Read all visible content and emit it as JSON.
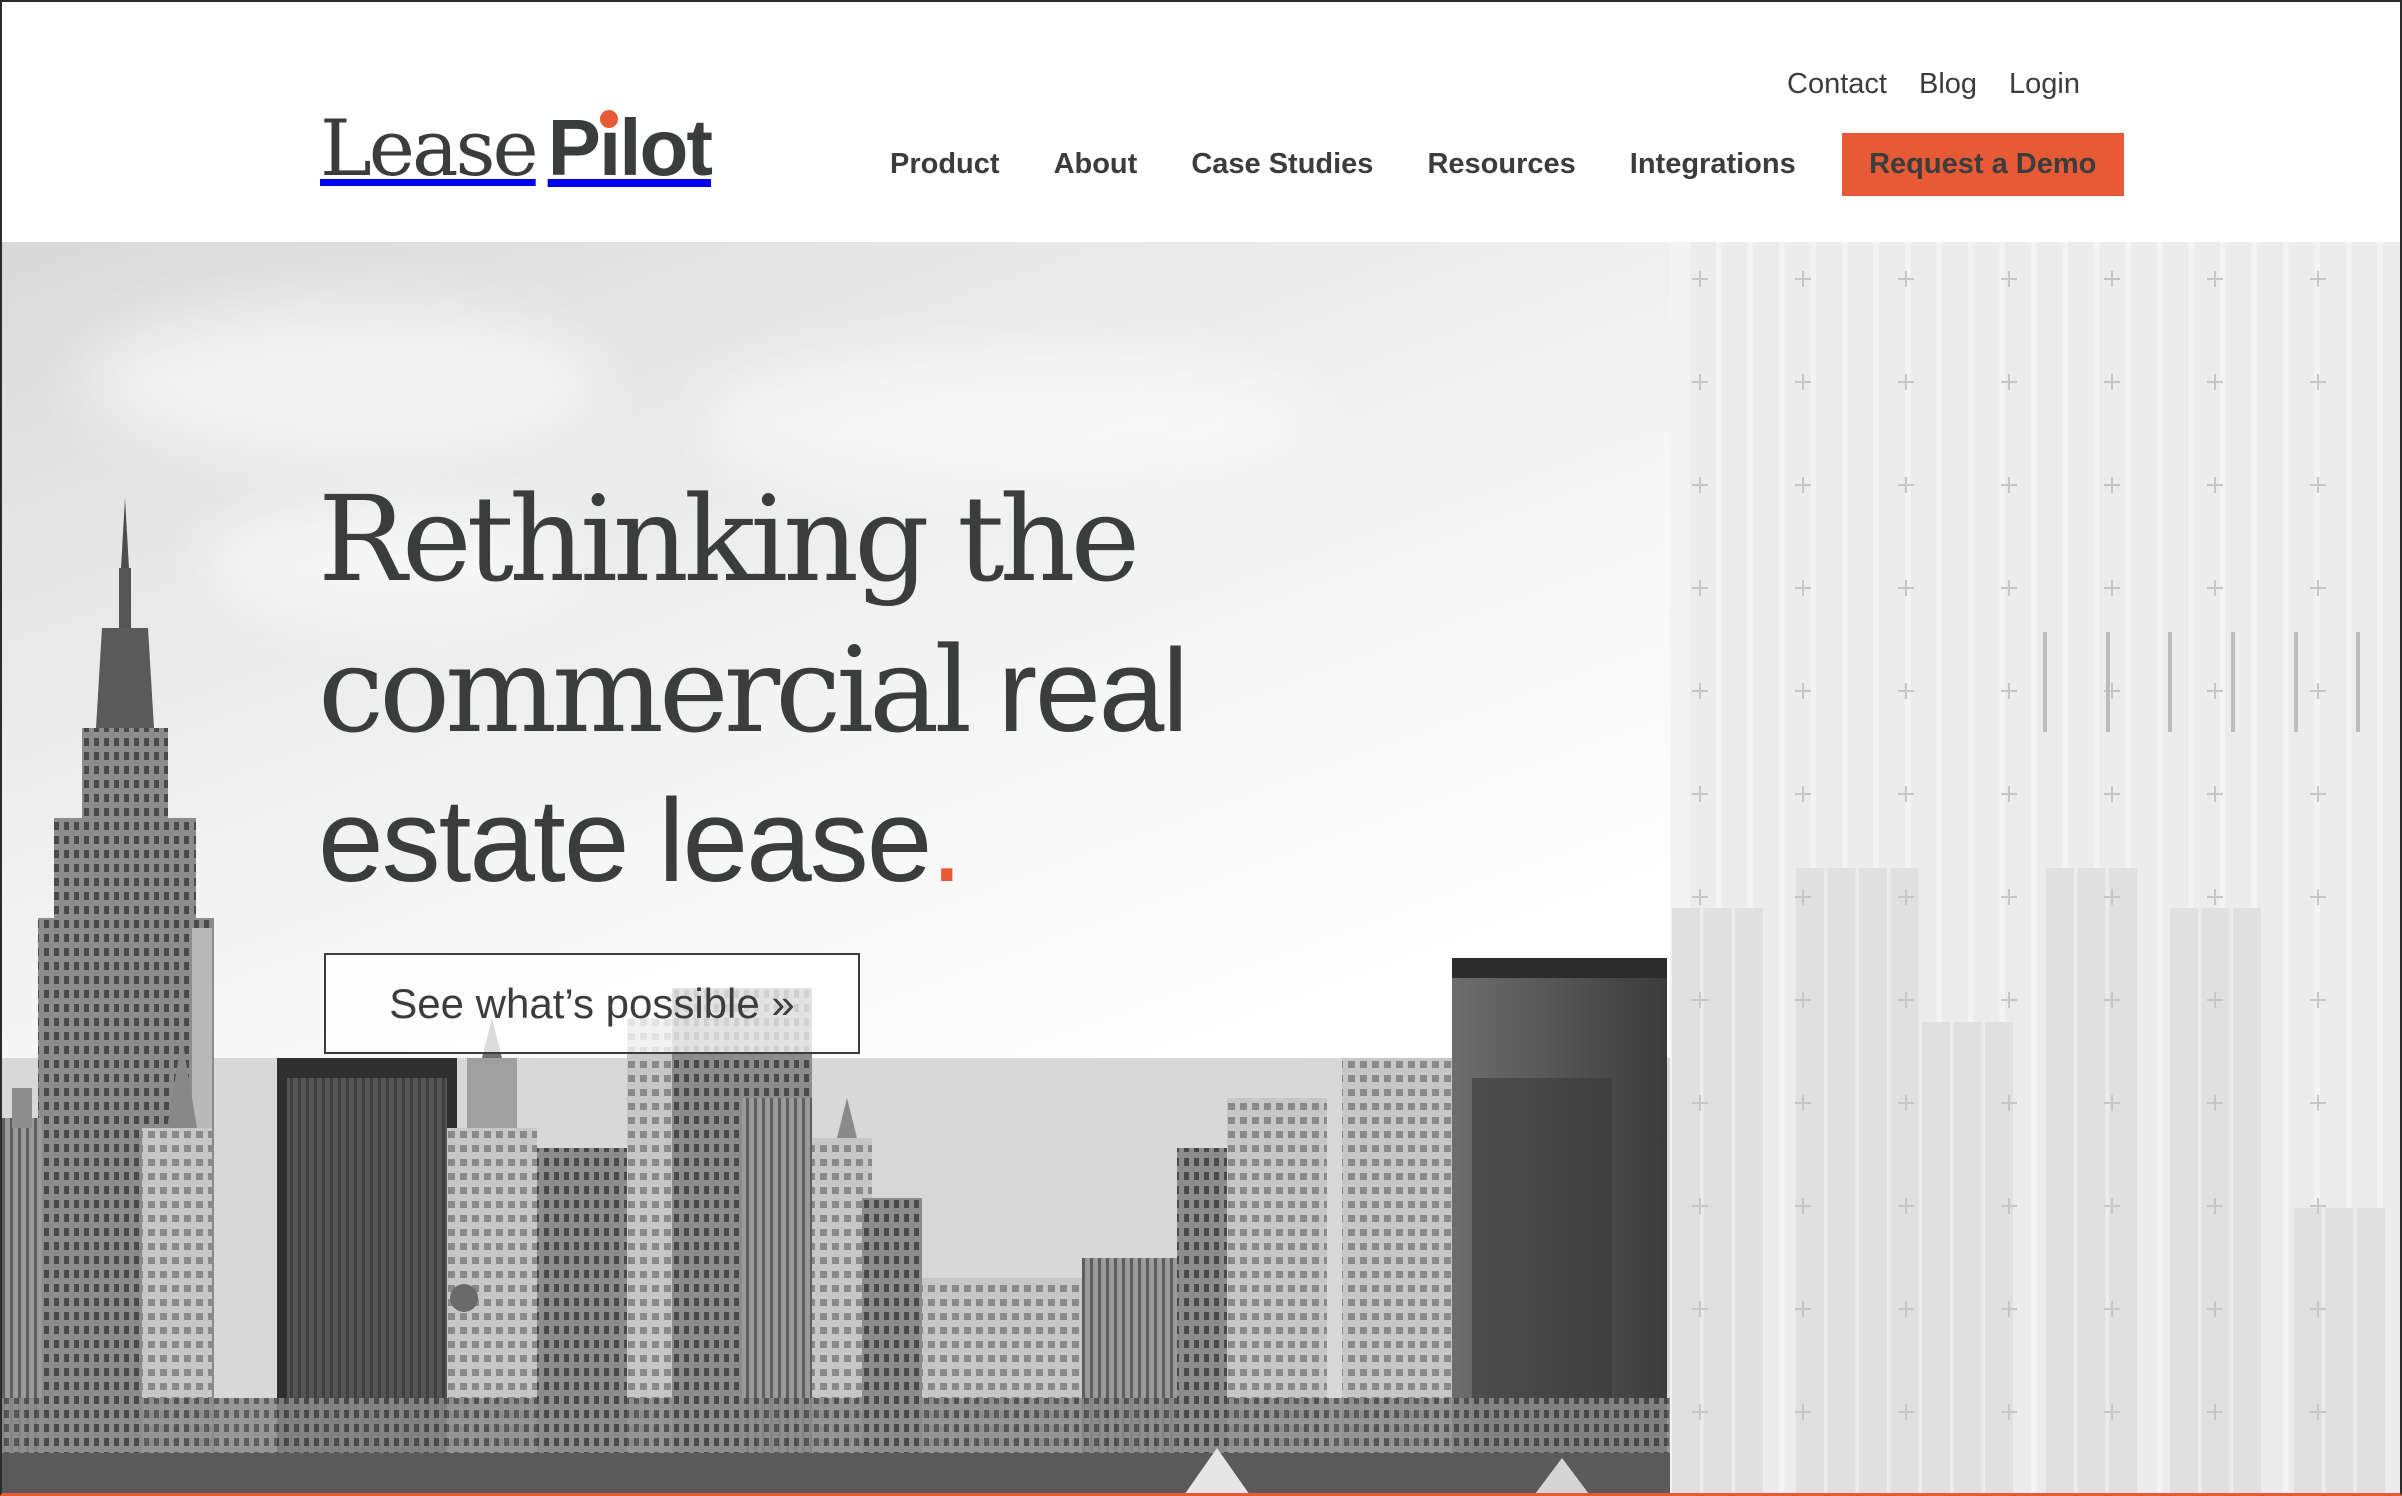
{
  "brand": {
    "name_part1": "Lease",
    "name_part2": "Pilot",
    "accent_color": "#e65a35",
    "text_color": "#3a3d3c"
  },
  "utility_nav": {
    "contact": "Contact",
    "blog": "Blog",
    "login": "Login"
  },
  "main_nav": {
    "product": "Product",
    "about": "About",
    "case_studies": "Case Studies",
    "resources": "Resources",
    "integrations": "Integrations",
    "demo_button": "Request a Demo"
  },
  "hero": {
    "line1": "Rethinking the",
    "line2_serif": "commercial",
    "line2_sans": "real",
    "line3": "estate lease",
    "period": ".",
    "cta_label": "See what’s possible »"
  }
}
